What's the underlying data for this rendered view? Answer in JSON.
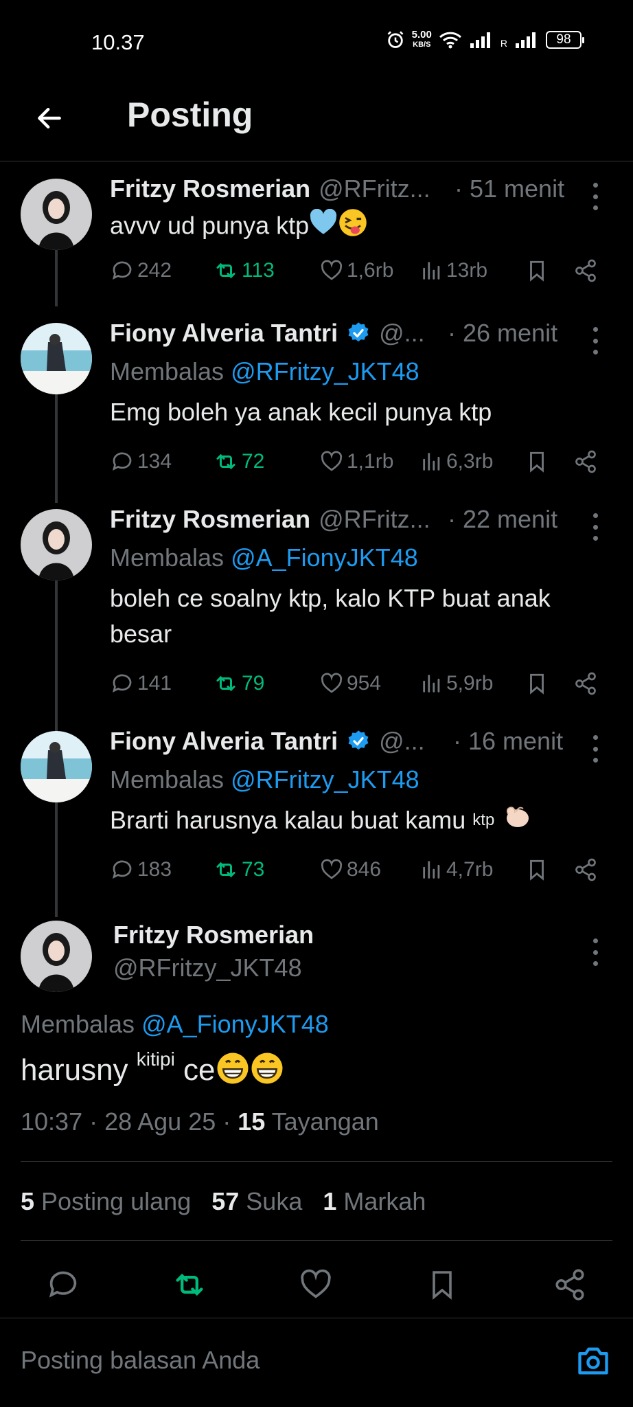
{
  "status_bar": {
    "time": "10.37",
    "speed_value": "5.00",
    "speed_unit": "KB/S",
    "signal_label": "R",
    "battery": "98"
  },
  "header": {
    "title": "Posting"
  },
  "thread": [
    {
      "name": "Fritzy Rosmerian",
      "handle": "@RFritz...",
      "time": "· 51 menit",
      "verified": false,
      "reply_prefix": "",
      "reply_mention": "",
      "text": "avvv ud punya ktp",
      "replies": "242",
      "reposts": "113",
      "likes": "1,6rb",
      "views": "13rb"
    },
    {
      "name": "Fiony Alveria Tantri",
      "handle": "@...",
      "time": "· 26 menit",
      "verified": true,
      "reply_prefix": "Membalas",
      "reply_mention": "@RFritzy_JKT48",
      "text": "Emg boleh ya anak kecil punya ktp",
      "replies": "134",
      "reposts": "72",
      "likes": "1,1rb",
      "views": "6,3rb"
    },
    {
      "name": "Fritzy Rosmerian",
      "handle": "@RFritz...",
      "time": "· 22 menit",
      "verified": false,
      "reply_prefix": "Membalas",
      "reply_mention": "@A_FionyJKT48",
      "text": "boleh ce soalny ktp, kalo KTP buat anak besar",
      "replies": "141",
      "reposts": "79",
      "likes": "954",
      "views": "5,9rb"
    },
    {
      "name": "Fiony Alveria Tantri",
      "handle": "@...",
      "time": "· 16 menit",
      "verified": true,
      "reply_prefix": "Membalas",
      "reply_mention": "@RFritzy_JKT48",
      "text": "Brarti harusnya kalau buat kamu",
      "text_sup": "ktp",
      "replies": "183",
      "reposts": "73",
      "likes": "846",
      "views": "4,7rb"
    }
  ],
  "main_tweet": {
    "name": "Fritzy Rosmerian",
    "handle": "@RFritzy_JKT48",
    "reply_prefix": "Membalas",
    "reply_mention": "@A_FionyJKT48",
    "text_before": "harusny",
    "text_sup": "kitipi",
    "text_after": "ce",
    "timestamp": "10:37 · 28 Agu 25 ·",
    "views_count": "15",
    "views_label": "Tayangan",
    "reposts_count": "5",
    "reposts_label": "Posting ulang",
    "likes_count": "57",
    "likes_label": "Suka",
    "bookmarks_count": "1",
    "bookmarks_label": "Markah"
  },
  "reply_bar": {
    "placeholder": "Posting balasan Anda"
  },
  "colors": {
    "background": "#000000",
    "text": "#e7e9ea",
    "muted": "#71767b",
    "mention": "#1d9bf0",
    "repost": "#00ba7c",
    "divider": "#2f3336"
  }
}
